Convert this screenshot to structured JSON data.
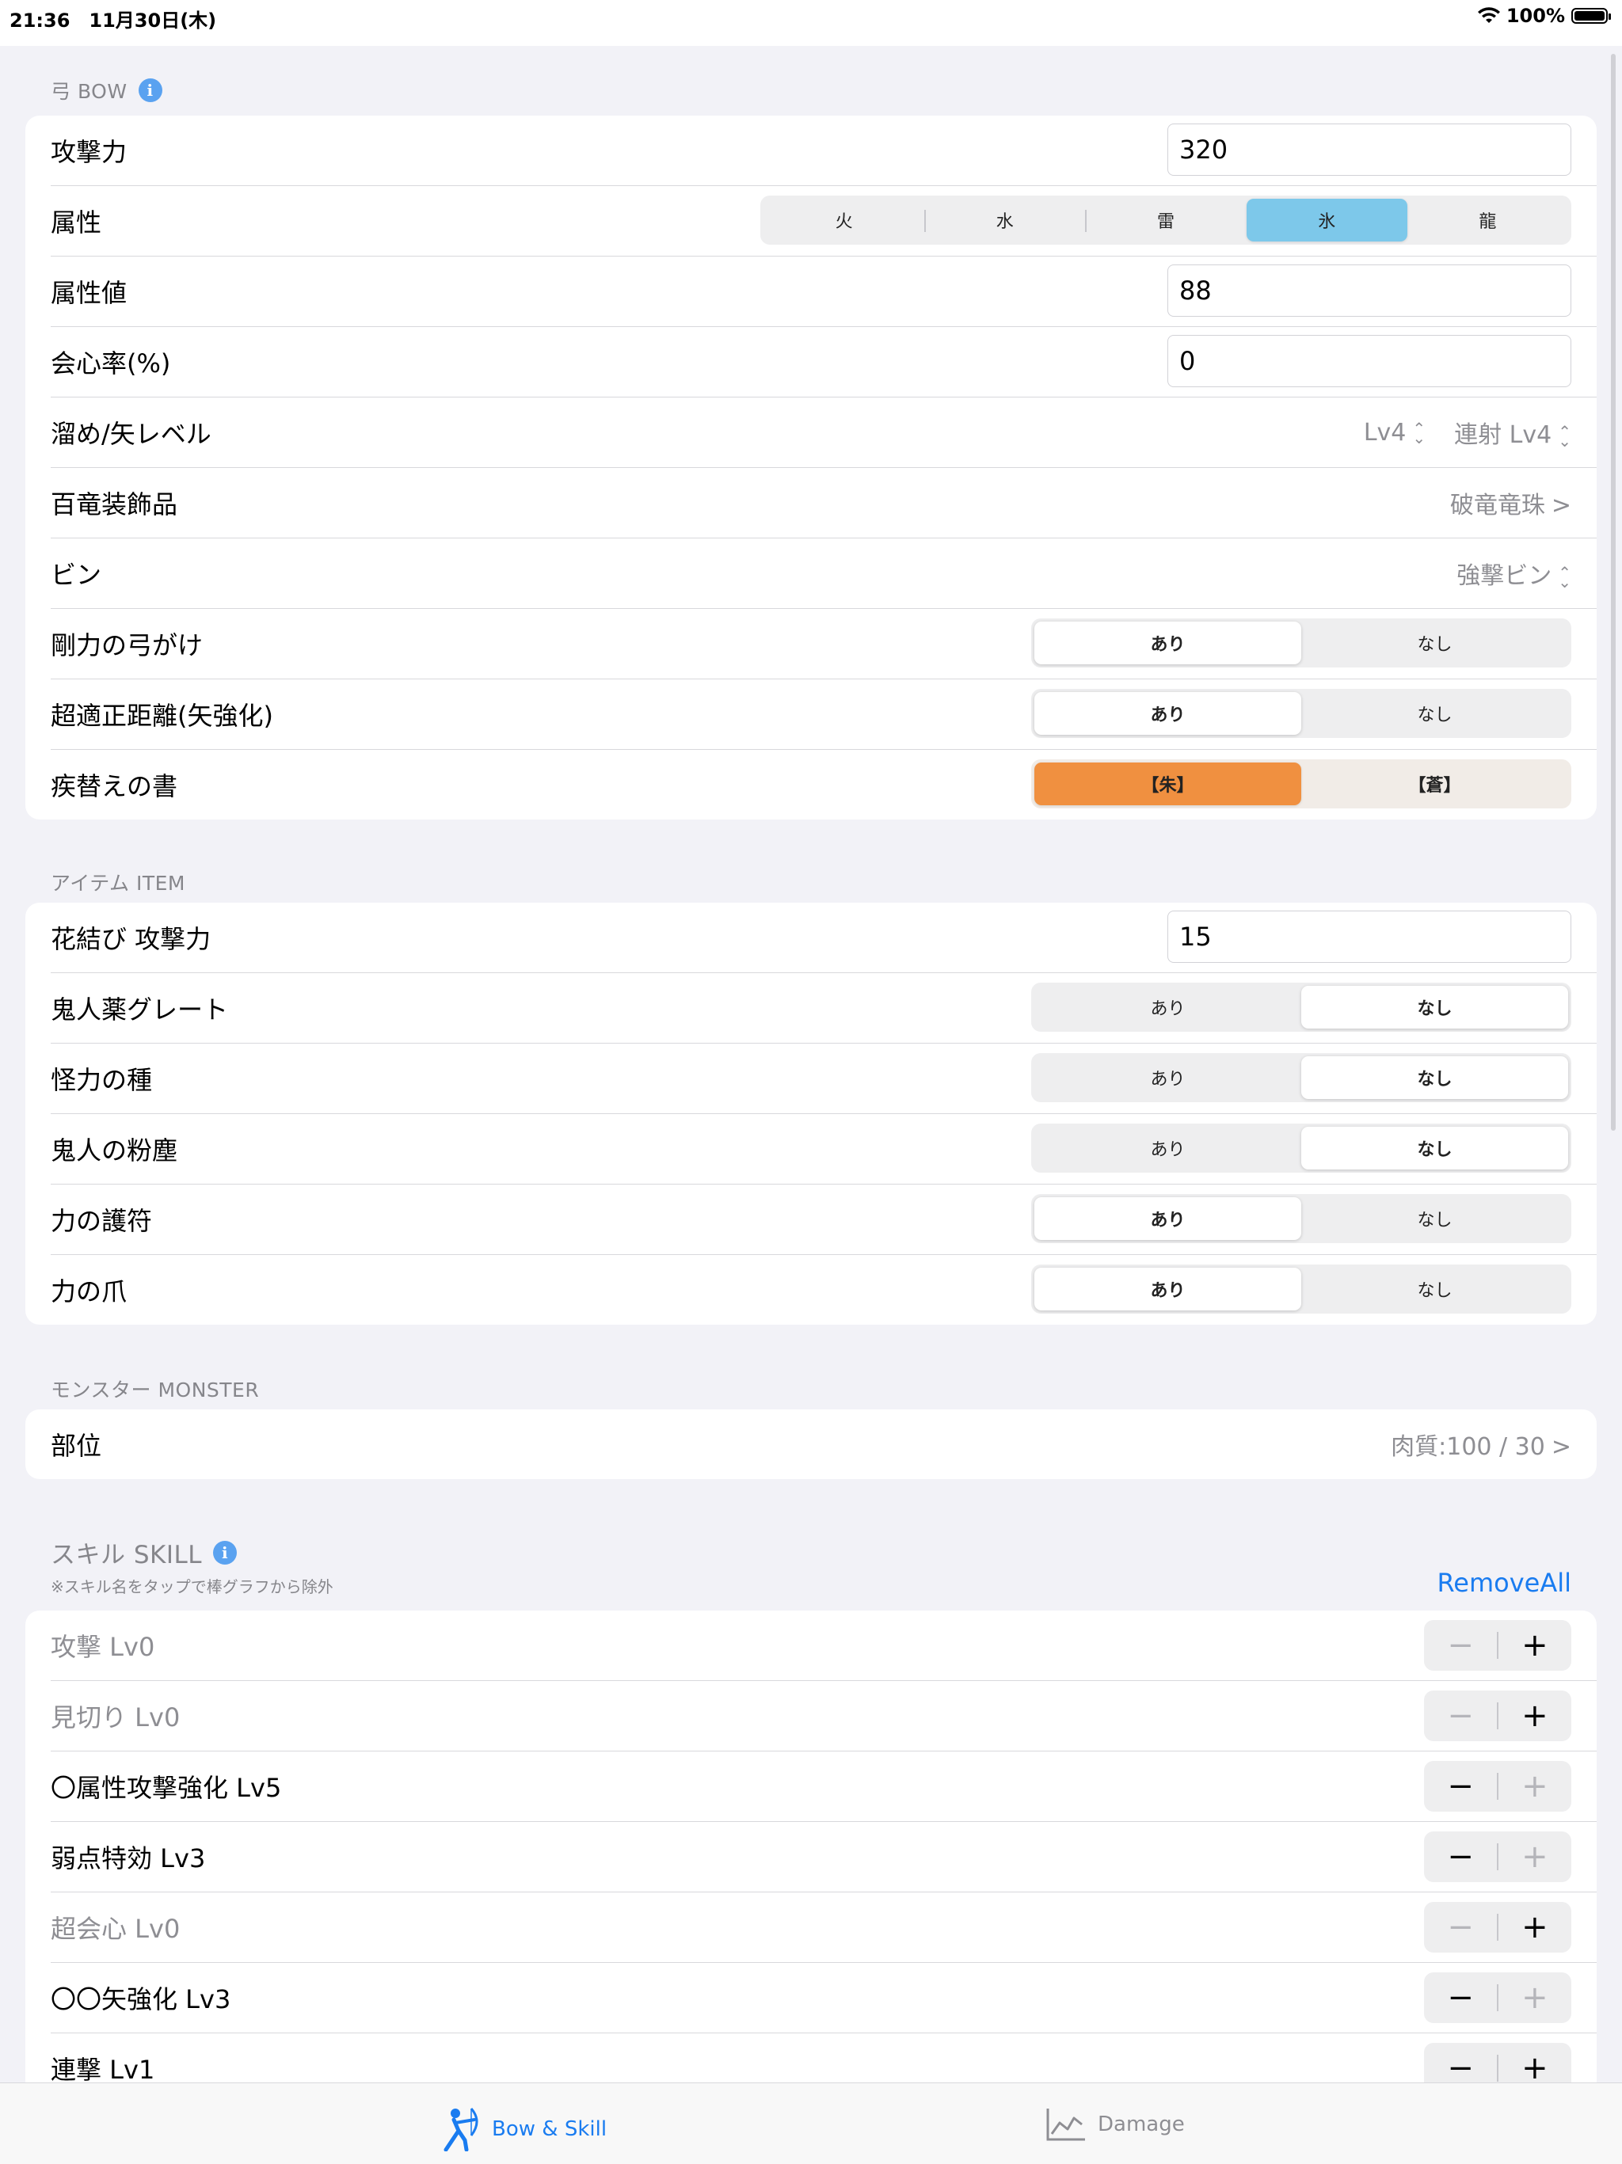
{
  "status_bar": {
    "time": "21:36",
    "date": "11月30日(木)",
    "battery": "100%"
  },
  "bow_section": {
    "header": "弓 BOW",
    "attack_label": "攻撃力",
    "attack_value": "320",
    "element_label": "属性",
    "element_options": [
      "火",
      "水",
      "雷",
      "氷",
      "龍"
    ],
    "element_selected": "氷",
    "element_value_label": "属性値",
    "element_value": "88",
    "crit_label": "会心率(%)",
    "crit_value": "0",
    "charge_label": "溜め/矢レベル",
    "charge_value": "Lv4",
    "shot_value": "連射 Lv4",
    "decoration_label": "百竜装飾品",
    "decoration_value": "破竜竜珠",
    "coating_label": "ビン",
    "coating_value": "強撃ビン",
    "power_label": "剛力の弓がけ",
    "power_options": [
      "あり",
      "なし"
    ],
    "power_selected": "あり",
    "distance_label": "超適正距離(矢強化)",
    "distance_options": [
      "あり",
      "なし"
    ],
    "distance_selected": "あり",
    "scroll_label": "疾替えの書",
    "scroll_options": [
      "【朱】",
      "【蒼】"
    ],
    "scroll_selected": "【朱】"
  },
  "item_section": {
    "header": "アイテム ITEM",
    "petalace_label": "花結び 攻撃力",
    "petalace_value": "15",
    "demon_drug_label": "鬼人薬グレート",
    "demon_drug_options": [
      "あり",
      "なし"
    ],
    "demon_drug_selected": "なし",
    "might_seed_label": "怪力の種",
    "might_seed_options": [
      "あり",
      "なし"
    ],
    "might_seed_selected": "なし",
    "demon_powder_label": "鬼人の粉塵",
    "demon_powder_options": [
      "あり",
      "なし"
    ],
    "demon_powder_selected": "なし",
    "charm_label": "力の護符",
    "charm_options": [
      "あり",
      "なし"
    ],
    "charm_selected": "あり",
    "talon_label": "力の爪",
    "talon_options": [
      "あり",
      "なし"
    ],
    "talon_selected": "あり"
  },
  "monster_section": {
    "header": "モンスター MONSTER",
    "part_label": "部位",
    "part_value": "肉質:100 / 30"
  },
  "skill_section": {
    "header": "スキル SKILL",
    "note": "※スキル名をタップで棒グラフから除外",
    "remove_all": "RemoveAll",
    "skills": [
      {
        "label": "攻撃 Lv0",
        "level": 0
      },
      {
        "label": "見切り Lv0",
        "level": 0
      },
      {
        "label": "〇属性攻撃強化 Lv5",
        "level": 5
      },
      {
        "label": "弱点特効 Lv3",
        "level": 3
      },
      {
        "label": "超会心 Lv0",
        "level": 0
      },
      {
        "label": "〇〇矢強化 Lv3",
        "level": 3
      },
      {
        "label": "連撃 Lv1",
        "level": 1
      }
    ]
  },
  "tab_bar": {
    "tab1": "Bow & Skill",
    "tab2": "Damage",
    "active": "Bow & Skill"
  },
  "colors": {
    "accent": "#1a7cf0",
    "ice": "#7dc8ea",
    "orange": "#f09040",
    "background": "#f2f2f7"
  }
}
